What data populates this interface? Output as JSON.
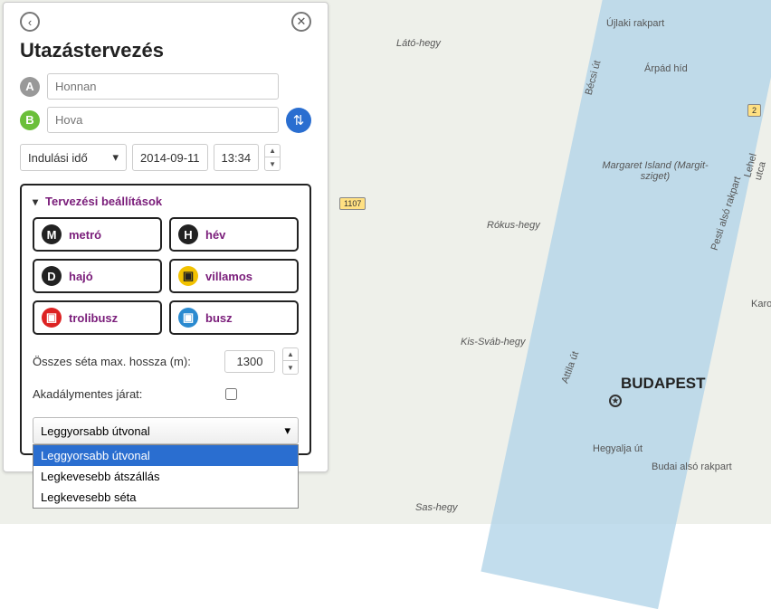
{
  "map": {
    "city": "BUDAPEST",
    "labels": {
      "lato": "Látó-hegy",
      "rokus": "Rókus-hegy",
      "kissvab": "Kis-Sváb-hegy",
      "sashegy": "Sas-hegy",
      "margit": "Margaret Island (Margit-sziget)",
      "arpad": "Árpád híd",
      "hegyalja": "Hegyalja út",
      "budai": "Budai alsó rakpart",
      "becsi": "Bécsi út",
      "ujlaki": "Újlaki rakpart",
      "attila": "Attila út",
      "lehel": "Lehel utca",
      "karo": "Karo",
      "pesti": "Pesti alsó rakpart"
    },
    "roads": {
      "r1107": "1107",
      "r2": "2"
    }
  },
  "panel": {
    "title": "Utazástervezés",
    "pointA": "A",
    "pointB": "B",
    "from_ph": "Honnan",
    "to_ph": "Hova",
    "depart_label": "Indulási idő",
    "date": "2014-09-11",
    "time": "13:34",
    "settings_title": "Tervezési beállítások",
    "modes": {
      "metro": "metró",
      "hev": "hév",
      "hajo": "hajó",
      "villamos": "villamos",
      "trolibusz": "trolibusz",
      "busz": "busz"
    },
    "walk_label": "Összes séta max. hossza (m):",
    "walk_value": "1300",
    "accessible_label": "Akadálymentes járat:",
    "dropdown": {
      "selected": "Leggyorsabb útvonal",
      "opt1": "Leggyorsabb útvonal",
      "opt2": "Legkevesebb átszállás",
      "opt3": "Legkevesebb séta"
    }
  }
}
